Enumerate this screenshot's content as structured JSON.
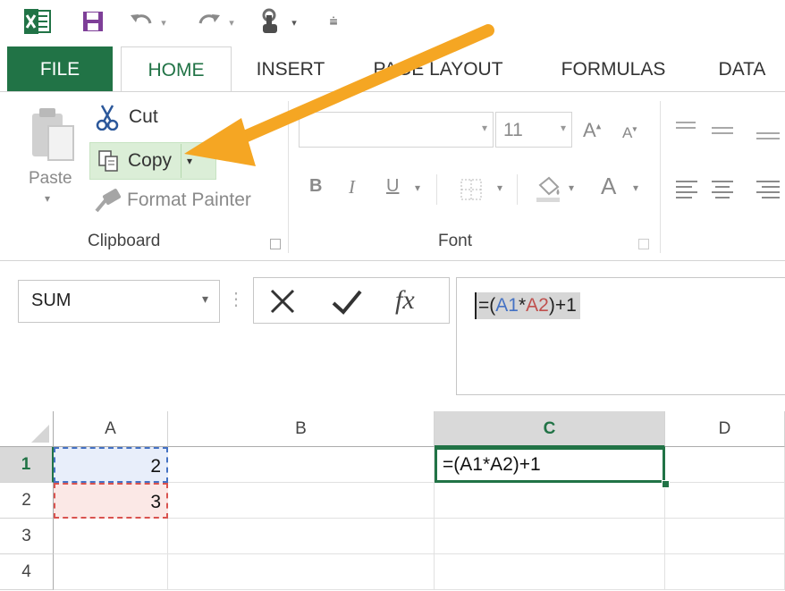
{
  "quick_access": {
    "icons": [
      "excel-logo-icon",
      "save-icon",
      "undo-icon",
      "redo-icon",
      "touch-mode-icon",
      "customize-qat-icon"
    ]
  },
  "tabs": [
    "FILE",
    "HOME",
    "INSERT",
    "PAGE LAYOUT",
    "FORMULAS",
    "DATA"
  ],
  "ribbon": {
    "clipboard": {
      "paste_label": "Paste",
      "cut_label": "Cut",
      "copy_label": "Copy",
      "format_painter_label": "Format Painter",
      "group_label": "Clipboard"
    },
    "font": {
      "font_name": "",
      "font_size": "11",
      "group_label": "Font",
      "bold": "B",
      "italic": "I",
      "underline": "U",
      "font_color_glyph": "A"
    }
  },
  "formula_bar": {
    "name_box": "SUM",
    "formula_parts": [
      {
        "text": "=(",
        "color": "#222222"
      },
      {
        "text": "A1",
        "color": "#4472c4"
      },
      {
        "text": "*",
        "color": "#222222"
      },
      {
        "text": "A2",
        "color": "#c0504d"
      },
      {
        "text": ")+1",
        "color": "#222222"
      }
    ],
    "fx_label": "fx"
  },
  "grid": {
    "columns": [
      "A",
      "B",
      "C",
      "D"
    ],
    "rows": [
      "1",
      "2",
      "3",
      "4"
    ],
    "active_column": "C",
    "active_row": "1",
    "cells": {
      "A1": "2",
      "A2": "3",
      "C1": "=(A1*A2)+1"
    }
  },
  "annotation": {
    "arrow_color": "#f5a623",
    "target": "copy-button"
  }
}
